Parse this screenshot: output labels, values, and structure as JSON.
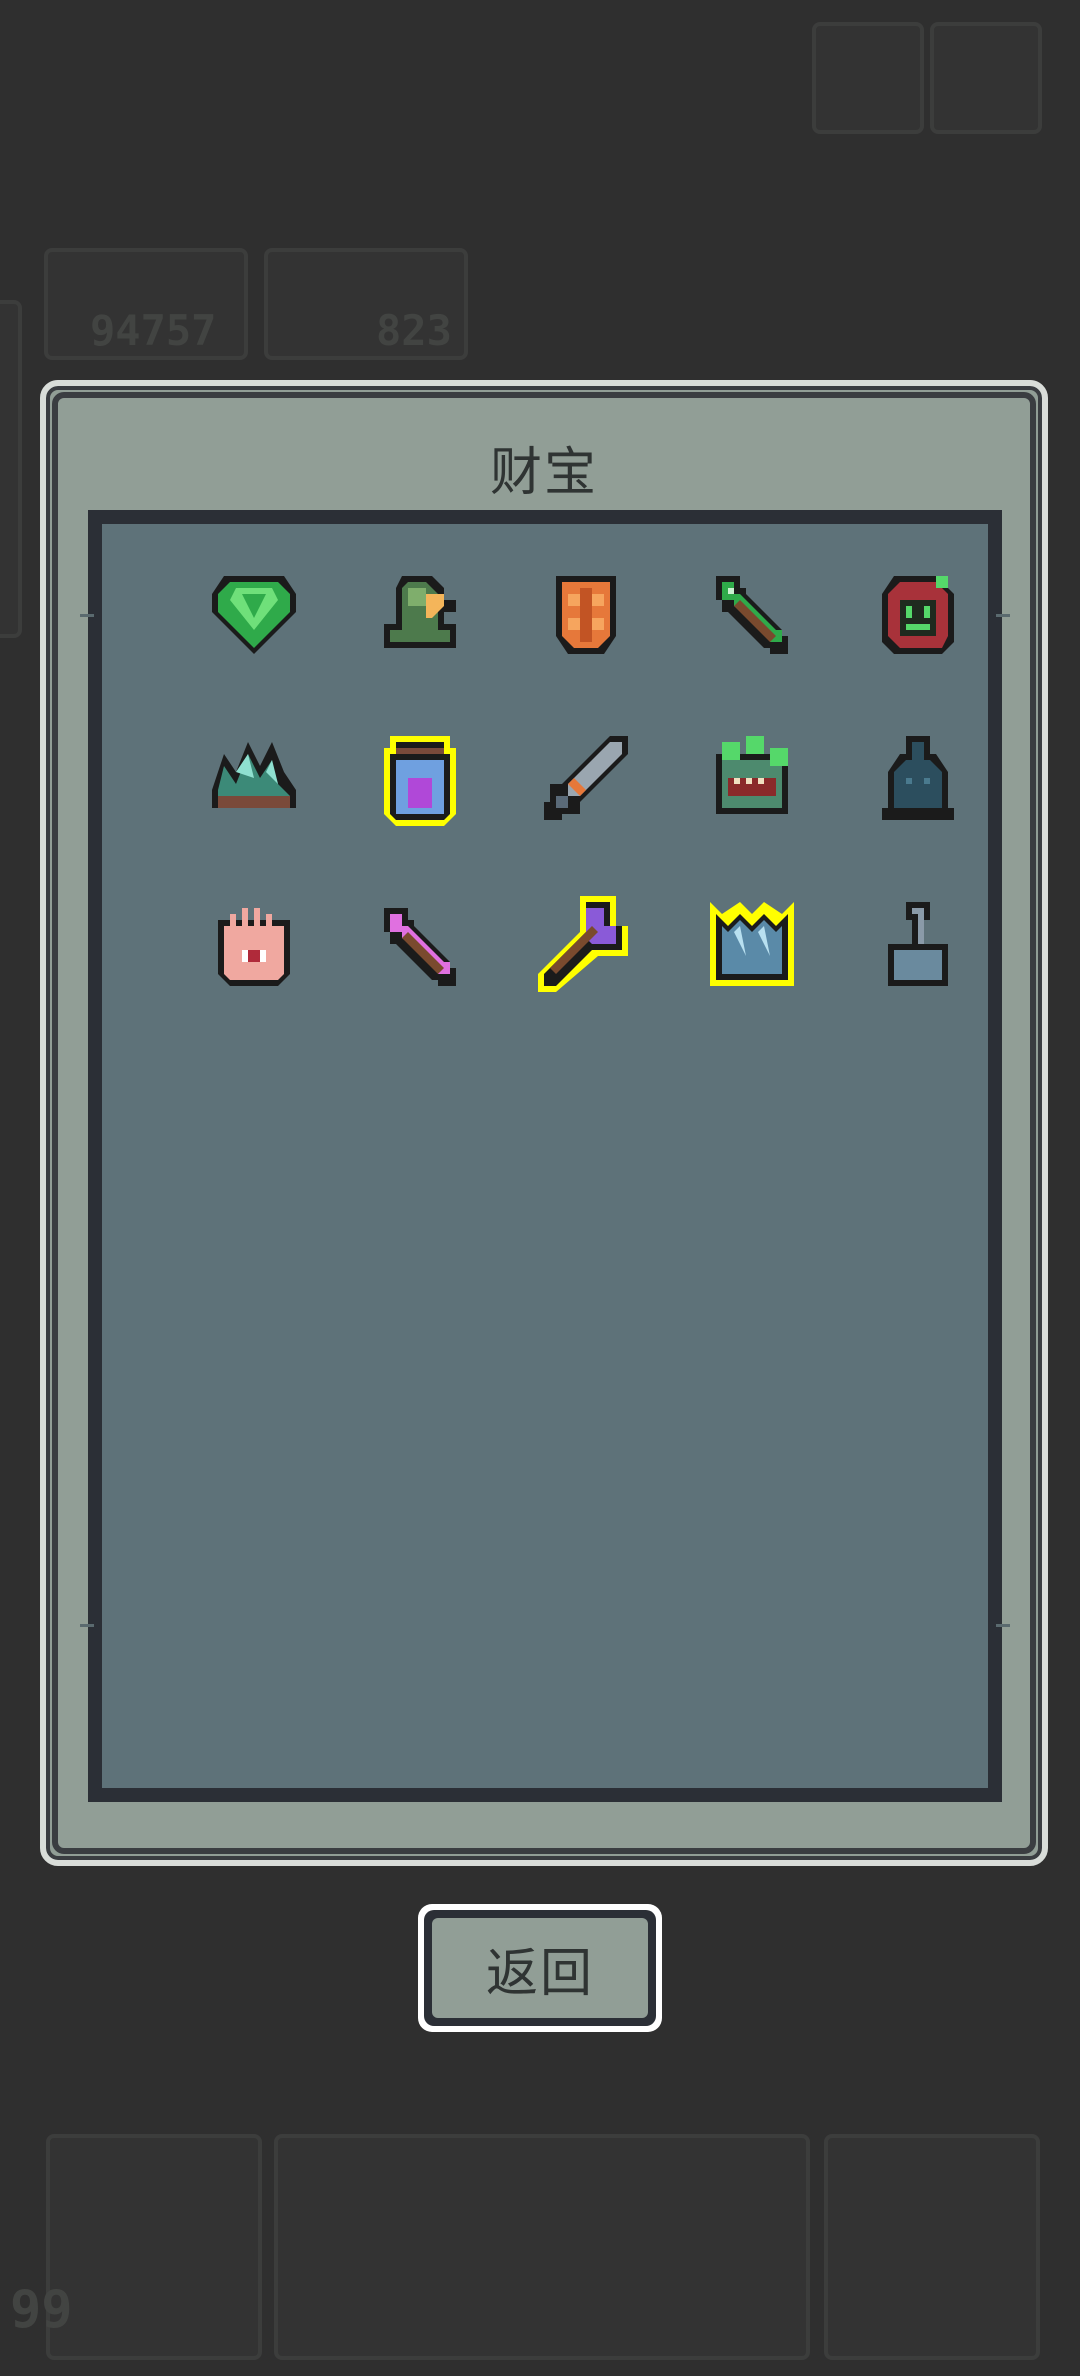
{
  "background": {
    "gem_count": "94757",
    "energy_count": "823",
    "level_badge": "99"
  },
  "dialog": {
    "title": "财宝",
    "back_label": "返回"
  },
  "treasure_items": [
    {
      "icon": "emerald-gem-icon",
      "highlighted": false
    },
    {
      "icon": "green-helmet-icon",
      "highlighted": false
    },
    {
      "icon": "orange-armor-icon",
      "highlighted": false
    },
    {
      "icon": "green-arrow-icon",
      "highlighted": false
    },
    {
      "icon": "red-hood-icon",
      "highlighted": false
    },
    {
      "icon": "crystal-rock-icon",
      "highlighted": false
    },
    {
      "icon": "purple-potion-jar-icon",
      "highlighted": true
    },
    {
      "icon": "dagger-icon",
      "highlighted": false
    },
    {
      "icon": "mimic-chest-icon",
      "highlighted": false
    },
    {
      "icon": "dark-bell-icon",
      "highlighted": false
    },
    {
      "icon": "eye-palm-icon",
      "highlighted": false
    },
    {
      "icon": "pink-arrow-icon",
      "highlighted": false
    },
    {
      "icon": "purple-axe-icon",
      "highlighted": true
    },
    {
      "icon": "ice-crystal-icon",
      "highlighted": true
    },
    {
      "icon": "lever-switch-icon",
      "highlighted": false
    }
  ],
  "colors": {
    "panel_frame": "#919e96",
    "panel_inner": "#5e7279",
    "highlight": "#ffff00",
    "page_bg": "#2f2f2f"
  }
}
